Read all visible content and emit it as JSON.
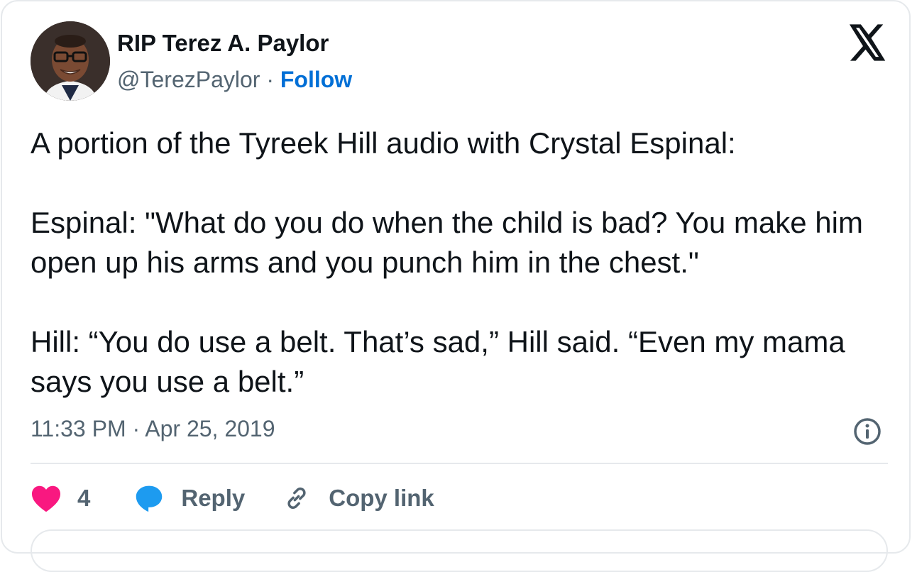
{
  "author": {
    "name": "RIP Terez A. Paylor",
    "handle": "@TerezPaylor",
    "separator": "·",
    "follow_label": "Follow"
  },
  "logo": {
    "icon": "x-logo-icon"
  },
  "tweet": {
    "paragraphs": [
      "A portion of the Tyreek Hill audio with Crystal Espinal:",
      "Espinal: \"What do you do when the child is bad? You make him open up his arms and you punch him in the chest.\"",
      "Hill: “You do use a belt. That’s sad,” Hill said. “Even my mama says you use a belt.”"
    ],
    "timestamp": "11:33 PM · Apr 25, 2019"
  },
  "actions": {
    "like_count": "4",
    "reply_label": "Reply",
    "copy_link_label": "Copy link"
  },
  "colors": {
    "text": "#0f1419",
    "muted": "#536471",
    "follow": "#006fd6",
    "like": "#f91880",
    "reply": "#1d9bf0",
    "border": "#e6e9ec"
  }
}
